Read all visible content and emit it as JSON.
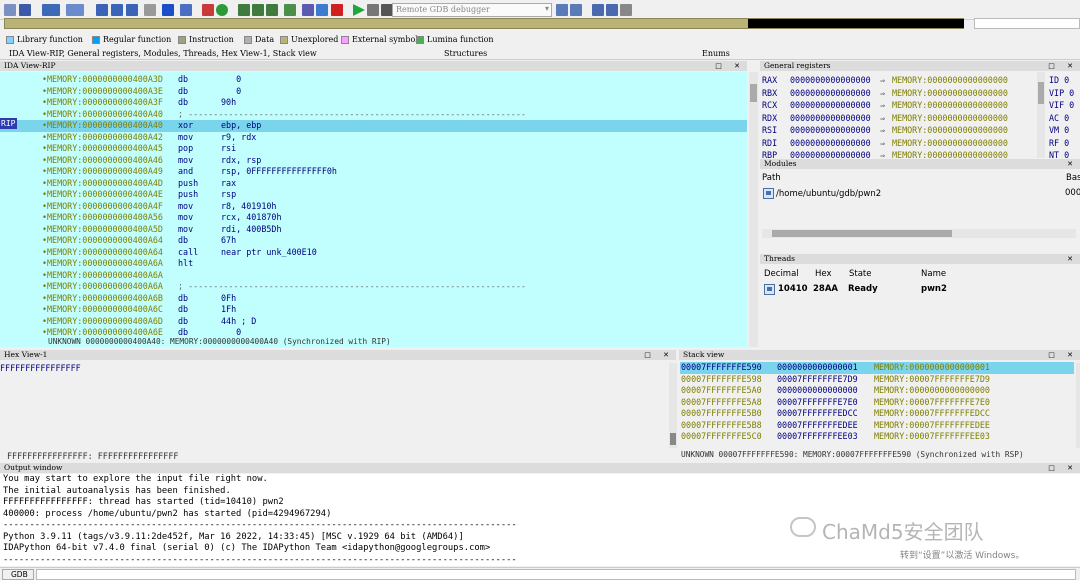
{
  "toolbar": {
    "debugger_label": "Remote GDB debugger"
  },
  "legend": [
    {
      "label": "Library function",
      "color": "#7fd4ff"
    },
    {
      "label": "Regular function",
      "color": "#00a0ff"
    },
    {
      "label": "Instruction",
      "color": "#a0a080"
    },
    {
      "label": "Data",
      "color": "#b0b0b0"
    },
    {
      "label": "Unexplored",
      "color": "#b9b375"
    },
    {
      "label": "External symbol",
      "color": "#ff9cff"
    },
    {
      "label": "Lumina function",
      "color": "#4caf50"
    }
  ],
  "tabs": [
    "IDA View-RIP, General registers, Modules, Threads, Hex View-1, Stack view",
    "Structures",
    "Enums"
  ],
  "ida": {
    "title": "IDA View-RIP",
    "rip_label": "RIP",
    "lines": [
      {
        "addr": "MEMORY:0000000000400A3D",
        "mn": "db",
        "op": "   0"
      },
      {
        "addr": "MEMORY:0000000000400A3E",
        "mn": "db",
        "op": "   0"
      },
      {
        "addr": "MEMORY:0000000000400A3F",
        "mn": "db",
        "op": "90h"
      },
      {
        "addr": "MEMORY:0000000000400A40",
        "mn": "; -------------------------------------------------------------------",
        "op": ""
      },
      {
        "addr": "MEMORY:0000000000400A40",
        "mn": "xor",
        "op": "ebp, ebp"
      },
      {
        "addr": "MEMORY:0000000000400A42",
        "mn": "mov",
        "op": "r9, rdx"
      },
      {
        "addr": "MEMORY:0000000000400A45",
        "mn": "pop",
        "op": "rsi"
      },
      {
        "addr": "MEMORY:0000000000400A46",
        "mn": "mov",
        "op": "rdx, rsp"
      },
      {
        "addr": "MEMORY:0000000000400A49",
        "mn": "and",
        "op": "rsp, 0FFFFFFFFFFFFFFF0h"
      },
      {
        "addr": "MEMORY:0000000000400A4D",
        "mn": "push",
        "op": "rax"
      },
      {
        "addr": "MEMORY:0000000000400A4E",
        "mn": "push",
        "op": "rsp"
      },
      {
        "addr": "MEMORY:0000000000400A4F",
        "mn": "mov",
        "op": "r8, 401910h"
      },
      {
        "addr": "MEMORY:0000000000400A56",
        "mn": "mov",
        "op": "rcx, 401870h"
      },
      {
        "addr": "MEMORY:0000000000400A5D",
        "mn": "mov",
        "op": "rdi, 400B5Dh"
      },
      {
        "addr": "MEMORY:0000000000400A64",
        "mn": "db",
        "op": "67h"
      },
      {
        "addr": "MEMORY:0000000000400A64",
        "mn": "call",
        "op": "near ptr unk_400E10"
      },
      {
        "addr": "MEMORY:0000000000400A6A",
        "mn": "hlt",
        "op": ""
      },
      {
        "addr": "MEMORY:0000000000400A6A",
        "mn": "",
        "op": ""
      },
      {
        "addr": "MEMORY:0000000000400A6A",
        "mn": "; -------------------------------------------------------------------",
        "op": ""
      },
      {
        "addr": "MEMORY:0000000000400A6B",
        "mn": "db",
        "op": "0Fh"
      },
      {
        "addr": "MEMORY:0000000000400A6C",
        "mn": "db",
        "op": "1Fh"
      },
      {
        "addr": "MEMORY:0000000000400A6D",
        "mn": "db",
        "op": "44h ; D"
      },
      {
        "addr": "MEMORY:0000000000400A6E",
        "mn": "db",
        "op": "   0"
      }
    ],
    "status": "UNKNOWN 0000000000400A40: MEMORY:0000000000400A40 (Synchronized with RIP)"
  },
  "registers": {
    "title": "General registers",
    "rows": [
      {
        "name": "RAX",
        "value": "0000000000000000",
        "mem": "MEMORY:0000000000000000"
      },
      {
        "name": "RBX",
        "value": "0000000000000000",
        "mem": "MEMORY:0000000000000000"
      },
      {
        "name": "RCX",
        "value": "0000000000000000",
        "mem": "MEMORY:0000000000000000"
      },
      {
        "name": "RDX",
        "value": "0000000000000000",
        "mem": "MEMORY:0000000000000000"
      },
      {
        "name": "RSI",
        "value": "0000000000000000",
        "mem": "MEMORY:0000000000000000"
      },
      {
        "name": "RDI",
        "value": "0000000000000000",
        "mem": "MEMORY:0000000000000000"
      },
      {
        "name": "RBP",
        "value": "0000000000000000",
        "mem": "MEMORY:0000000000000000"
      }
    ],
    "flags": [
      "ID 0",
      "VIP 0",
      "VIF 0",
      "AC 0",
      "VM 0",
      "RF 0",
      "NT 0"
    ]
  },
  "modules": {
    "title": "Modules",
    "col_path": "Path",
    "col_base": "Bas",
    "row_path": "/home/ubuntu/gdb/pwn2",
    "row_base": "000"
  },
  "threads": {
    "title": "Threads",
    "cols": [
      "Decimal",
      "Hex",
      "State",
      "Name"
    ],
    "row": [
      "10410",
      "28AA",
      "Ready",
      "pwn2"
    ]
  },
  "hexview": {
    "title": "Hex View-1",
    "row": "FFFFFFFFFFFFFFFF",
    "status": "FFFFFFFFFFFFFFFF: FFFFFFFFFFFFFFFF"
  },
  "stack": {
    "title": "Stack view",
    "rows": [
      {
        "addr": "00007FFFFFFFE590",
        "val": "0000000000000001",
        "mem": "MEMORY:0000000000000001"
      },
      {
        "addr": "00007FFFFFFFE598",
        "val": "00007FFFFFFFE7D9",
        "mem": "MEMORY:00007FFFFFFFE7D9"
      },
      {
        "addr": "00007FFFFFFFE5A0",
        "val": "0000000000000000",
        "mem": "MEMORY:0000000000000000"
      },
      {
        "addr": "00007FFFFFFFE5A8",
        "val": "00007FFFFFFFE7E0",
        "mem": "MEMORY:00007FFFFFFFE7E0"
      },
      {
        "addr": "00007FFFFFFFE5B0",
        "val": "00007FFFFFFFEDCC",
        "mem": "MEMORY:00007FFFFFFFEDCC"
      },
      {
        "addr": "00007FFFFFFFE5B8",
        "val": "00007FFFFFFFEDEE",
        "mem": "MEMORY:00007FFFFFFFEDEE"
      },
      {
        "addr": "00007FFFFFFFE5C0",
        "val": "00007FFFFFFFEE03",
        "mem": "MEMORY:00007FFFFFFFEE03"
      }
    ],
    "status": "UNKNOWN 00007FFFFFFFE590: MEMORY:00007FFFFFFFE590 (Synchronized with RSP)"
  },
  "output": {
    "title": "Output window",
    "lines": [
      "You may start to explore the input file right now.",
      "The initial autoanalysis has been finished.",
      "FFFFFFFFFFFFFFFF: thread has started (tid=10410) pwn2",
      "400000: process /home/ubuntu/pwn2 has started (pid=4294967294)",
      "-------------------------------------------------------------------------------------------------",
      "Python 3.9.11 (tags/v3.9.11:2de452f, Mar 16 2022, 14:33:45) [MSC v.1929 64 bit (AMD64)]",
      "IDAPython 64-bit v7.4.0 final (serial 0) (c) The IDAPython Team <idapython@googlegroups.com>",
      "-------------------------------------------------------------------------------------------------"
    ]
  },
  "gdb": {
    "label": "GDB"
  },
  "watermark": {
    "text": "ChaMd5安全团队",
    "sub": "转到“设置”以激活 Windows。"
  }
}
